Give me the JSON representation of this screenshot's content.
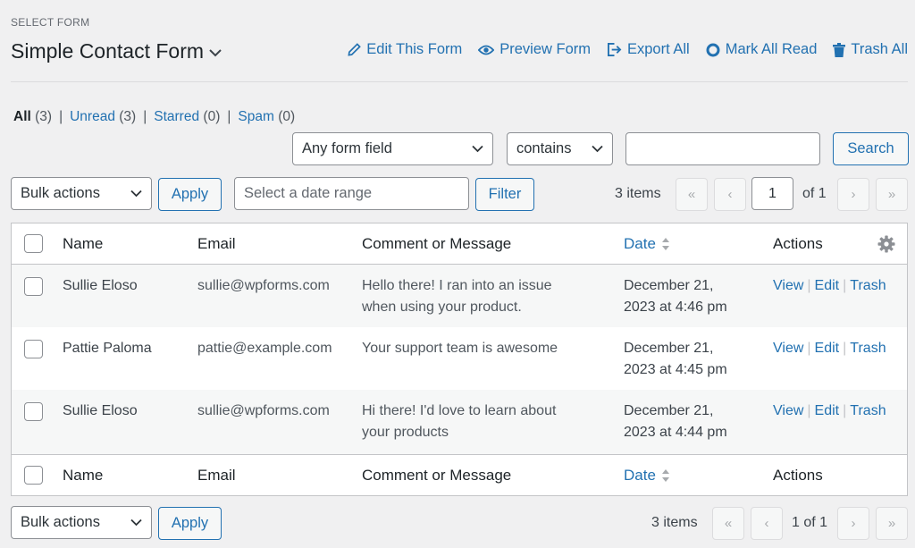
{
  "header": {
    "select_label": "SELECT FORM",
    "form_title": "Simple Contact Form",
    "actions": [
      {
        "label": "Edit This Form",
        "icon": "pencil-icon"
      },
      {
        "label": "Preview Form",
        "icon": "eye-icon"
      },
      {
        "label": "Export All",
        "icon": "export-icon"
      },
      {
        "label": "Mark All Read",
        "icon": "circle-icon"
      },
      {
        "label": "Trash All",
        "icon": "trash-icon"
      }
    ]
  },
  "views": [
    {
      "label": "All",
      "count": "(3)"
    },
    {
      "label": "Unread",
      "count": "(3)"
    },
    {
      "label": "Starred",
      "count": "(0)"
    },
    {
      "label": "Spam",
      "count": "(0)"
    }
  ],
  "search": {
    "field_select": "Any form field",
    "operator_select": "contains",
    "value": "",
    "button": "Search"
  },
  "toolbar": {
    "bulk_actions": "Bulk actions",
    "apply": "Apply",
    "date_placeholder": "Select a date range",
    "filter": "Filter",
    "items": "3 items",
    "first": "«",
    "prev": "‹",
    "page": "1",
    "of": "of 1",
    "next": "›",
    "last": "»"
  },
  "bottom_toolbar": {
    "bulk_actions": "Bulk actions",
    "apply": "Apply",
    "items": "3 items",
    "first": "«",
    "prev": "‹",
    "page_text": "1 of 1",
    "next": "›",
    "last": "»"
  },
  "table": {
    "columns": {
      "name": "Name",
      "email": "Email",
      "message": "Comment or Message",
      "date": "Date",
      "actions": "Actions"
    },
    "rows": [
      {
        "name": "Sullie Eloso",
        "email": "sullie@wpforms.com",
        "message_l1": "Hello there! I ran into an issue",
        "message_l2": "when using your product.",
        "date_l1": "December 21,",
        "date_l2": "2023 at 4:46 pm"
      },
      {
        "name": "Pattie Paloma",
        "email": "pattie@example.com",
        "message_l1": "Your support team is awesome",
        "message_l2": "",
        "date_l1": "December 21,",
        "date_l2": "2023 at 4:45 pm"
      },
      {
        "name": "Sullie Eloso",
        "email": "sullie@wpforms.com",
        "message_l1": "Hi there! I'd love to learn about",
        "message_l2": "your products",
        "date_l1": "December 21,",
        "date_l2": "2023 at 4:44 pm"
      }
    ],
    "row_actions": {
      "view": "View",
      "edit": "Edit",
      "trash": "Trash",
      "sep": "|"
    }
  }
}
